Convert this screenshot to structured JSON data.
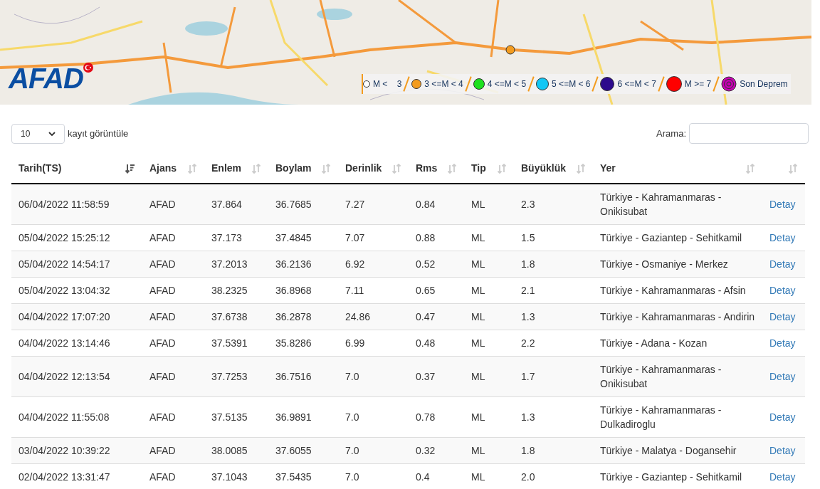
{
  "logo": {
    "text": "AFAD"
  },
  "legend": [
    {
      "label": "M <    3",
      "color": "#ffffff",
      "kind": "dot"
    },
    {
      "label": "3 <=M < 4",
      "color": "#f39c1f",
      "kind": "dot"
    },
    {
      "label": "4 <=M < 5",
      "color": "#1ee01e",
      "kind": "dot"
    },
    {
      "label": "5 <=M < 6",
      "color": "#13c7f5",
      "kind": "dot"
    },
    {
      "label": "6 <=M < 7",
      "color": "#2c0a8c",
      "kind": "dot"
    },
    {
      "label": "M >= 7",
      "color": "#ff0000",
      "kind": "dot"
    },
    {
      "label": "Son Deprem",
      "color": "#c800b4",
      "kind": "rings"
    }
  ],
  "length": {
    "value": "10",
    "suffix": "kayıt görüntüle"
  },
  "search": {
    "label": "Arama:"
  },
  "table": {
    "columns": [
      {
        "label": "Tarih(TS)",
        "sorted": true
      },
      {
        "label": "Ajans",
        "sorted": false
      },
      {
        "label": "Enlem",
        "sorted": false
      },
      {
        "label": "Boylam",
        "sorted": false
      },
      {
        "label": "Derinlik",
        "sorted": false
      },
      {
        "label": "Rms",
        "sorted": false
      },
      {
        "label": "Tip",
        "sorted": false
      },
      {
        "label": "Büyüklük",
        "sorted": false
      },
      {
        "label": "Yer",
        "sorted": false
      },
      {
        "sorted": false
      }
    ],
    "rows": [
      [
        "06/04/2022 11:58:59",
        "AFAD",
        "37.864",
        "36.7685",
        "7.27",
        "0.84",
        "ML",
        "2.3",
        "Türkiye - Kahramanmaras - Onikisubat",
        "Detay"
      ],
      [
        "05/04/2022 15:25:12",
        "AFAD",
        "37.173",
        "37.4845",
        "7.07",
        "0.88",
        "ML",
        "1.5",
        "Türkiye - Gaziantep - Sehitkamil",
        "Detay"
      ],
      [
        "05/04/2022 14:54:17",
        "AFAD",
        "37.2013",
        "36.2136",
        "6.92",
        "0.52",
        "ML",
        "1.8",
        "Türkiye - Osmaniye - Merkez",
        "Detay"
      ],
      [
        "05/04/2022 13:04:32",
        "AFAD",
        "38.2325",
        "36.8968",
        "7.11",
        "0.65",
        "ML",
        "2.1",
        "Türkiye - Kahramanmaras - Afsin",
        "Detay"
      ],
      [
        "04/04/2022 17:07:20",
        "AFAD",
        "37.6738",
        "36.2878",
        "24.86",
        "0.47",
        "ML",
        "1.3",
        "Türkiye - Kahramanmaras - Andirin",
        "Detay"
      ],
      [
        "04/04/2022 13:14:46",
        "AFAD",
        "37.5391",
        "35.8286",
        "6.99",
        "0.48",
        "ML",
        "2.2",
        "Türkiye - Adana - Kozan",
        "Detay"
      ],
      [
        "04/04/2022 12:13:54",
        "AFAD",
        "37.7253",
        "36.7516",
        "7.0",
        "0.37",
        "ML",
        "1.7",
        "Türkiye - Kahramanmaras - Onikisubat",
        "Detay"
      ],
      [
        "04/04/2022 11:55:08",
        "AFAD",
        "37.5135",
        "36.9891",
        "7.0",
        "0.78",
        "ML",
        "1.3",
        "Türkiye - Kahramanmaras - Dulkadiroglu",
        "Detay"
      ],
      [
        "03/04/2022 10:39:22",
        "AFAD",
        "38.0085",
        "37.6055",
        "7.0",
        "0.32",
        "ML",
        "1.8",
        "Türkiye - Malatya - Dogansehir",
        "Detay"
      ],
      [
        "02/04/2022 13:31:47",
        "AFAD",
        "37.1043",
        "37.5435",
        "7.0",
        "0.4",
        "ML",
        "2.0",
        "Türkiye - Gaziantep - Sehitkamil",
        "Detay"
      ]
    ]
  }
}
